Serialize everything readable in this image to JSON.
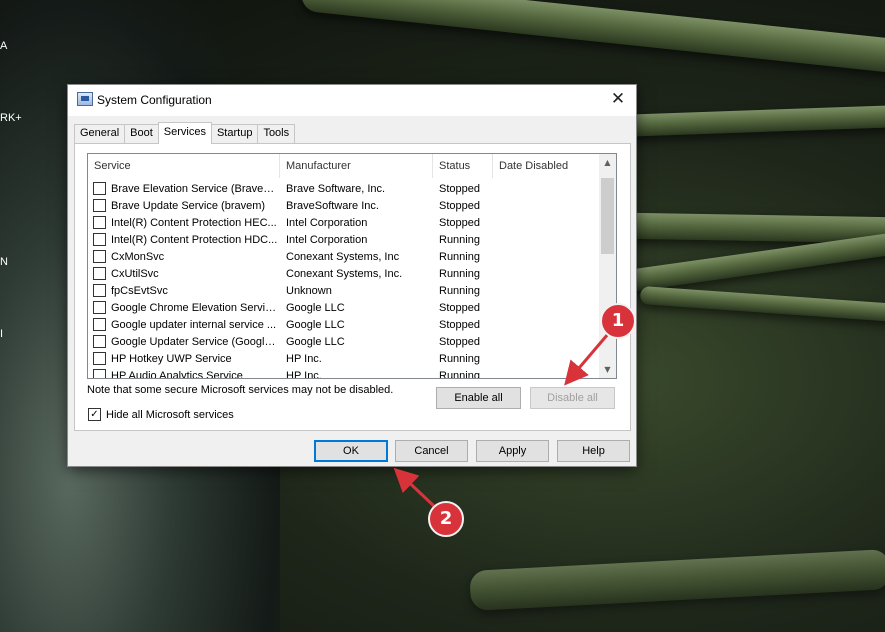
{
  "desktop": {
    "labels": [
      "A",
      "RK+",
      "N",
      "I"
    ]
  },
  "window": {
    "title": "System Configuration",
    "close_glyph": "✕"
  },
  "tabs": [
    {
      "label": "General",
      "active": false
    },
    {
      "label": "Boot",
      "active": false
    },
    {
      "label": "Services",
      "active": true
    },
    {
      "label": "Startup",
      "active": false
    },
    {
      "label": "Tools",
      "active": false
    }
  ],
  "services_list": {
    "columns": [
      "Service",
      "Manufacturer",
      "Status",
      "Date Disabled"
    ],
    "rows": [
      {
        "service": "Brave Elevation Service (BraveEl...",
        "manufacturer": "Brave Software, Inc.",
        "status": "Stopped",
        "date_disabled": ""
      },
      {
        "service": "Brave Update Service (bravem)",
        "manufacturer": "BraveSoftware Inc.",
        "status": "Stopped",
        "date_disabled": ""
      },
      {
        "service": "Intel(R) Content Protection HEC...",
        "manufacturer": "Intel Corporation",
        "status": "Stopped",
        "date_disabled": ""
      },
      {
        "service": "Intel(R) Content Protection HDC...",
        "manufacturer": "Intel Corporation",
        "status": "Running",
        "date_disabled": ""
      },
      {
        "service": "CxMonSvc",
        "manufacturer": "Conexant Systems, Inc",
        "status": "Running",
        "date_disabled": ""
      },
      {
        "service": "CxUtilSvc",
        "manufacturer": "Conexant Systems, Inc.",
        "status": "Running",
        "date_disabled": ""
      },
      {
        "service": "fpCsEvtSvc",
        "manufacturer": "Unknown",
        "status": "Running",
        "date_disabled": ""
      },
      {
        "service": "Google Chrome Elevation Servic...",
        "manufacturer": "Google LLC",
        "status": "Stopped",
        "date_disabled": ""
      },
      {
        "service": "Google updater internal service ...",
        "manufacturer": "Google LLC",
        "status": "Stopped",
        "date_disabled": ""
      },
      {
        "service": "Google Updater Service (Google...",
        "manufacturer": "Google LLC",
        "status": "Stopped",
        "date_disabled": ""
      },
      {
        "service": "HP Hotkey UWP Service",
        "manufacturer": "HP Inc.",
        "status": "Running",
        "date_disabled": ""
      },
      {
        "service": "HP Audio Analytics Service",
        "manufacturer": "HP Inc.",
        "status": "Running",
        "date_disabled": ""
      }
    ],
    "scroll_up_glyph": "▲",
    "scroll_down_glyph": "▼"
  },
  "note_text": "Note that some secure Microsoft services may not be disabled.",
  "buttons": {
    "enable_all": "Enable all",
    "disable_all": "Disable all",
    "ok": "OK",
    "cancel": "Cancel",
    "apply": "Apply",
    "help": "Help"
  },
  "hide_ms": {
    "label": "Hide all Microsoft services",
    "checked": true,
    "check_glyph": "✓"
  },
  "annotations": [
    {
      "number": "1",
      "color": "#d8333a"
    },
    {
      "number": "2",
      "color": "#d8333a"
    }
  ]
}
